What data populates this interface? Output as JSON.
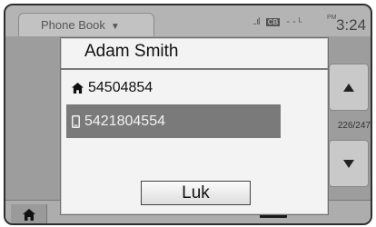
{
  "statusbar": {
    "tab_label": "Phone Book",
    "signal": "..ıl",
    "cell_badge": "CB",
    "network": "- - ᴸ",
    "pm_label": "PM",
    "clock": "3:24"
  },
  "list": {
    "counter": "226/247"
  },
  "dialog": {
    "title": "Adam Smith",
    "numbers": [
      {
        "type": "home-icon",
        "value": "54504854",
        "selected": false
      },
      {
        "type": "mobile-icon",
        "value": "5421804554",
        "selected": true
      }
    ],
    "close_label": "Luk"
  },
  "colors": {
    "highlight": "#7a7a7a",
    "dialog_bg": "#f3f3f3",
    "screen_bg": "#9a9a9a"
  }
}
